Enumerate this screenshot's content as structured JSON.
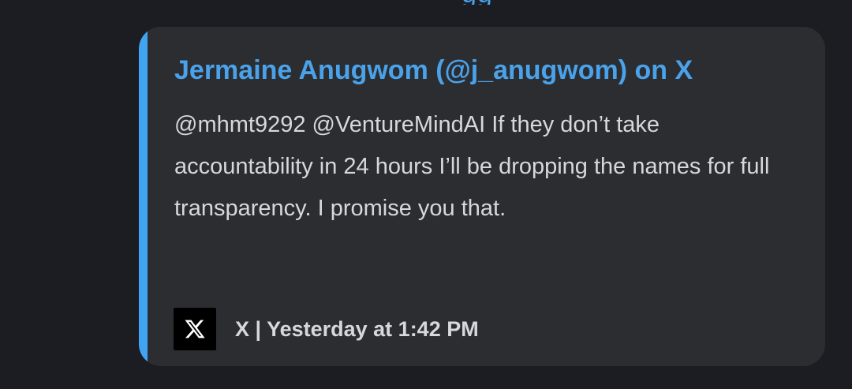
{
  "page": {
    "background": "#1c1d22",
    "top_fragment_text": "gg"
  },
  "embed": {
    "accent_color": "#41a4f2",
    "background": "#2b2d31",
    "title": "Jermaine Anugwom (@j_anugwom) on X",
    "title_color": "#4aa2ea",
    "description": "@mhmt9292 @VentureMindAI If they don’t take accountability in 24 hours I’ll be dropping the names for full transparency. I promise you that.",
    "footer": {
      "icon": "x-logo-icon",
      "text": "X | Yesterday at 1:42 PM"
    }
  }
}
